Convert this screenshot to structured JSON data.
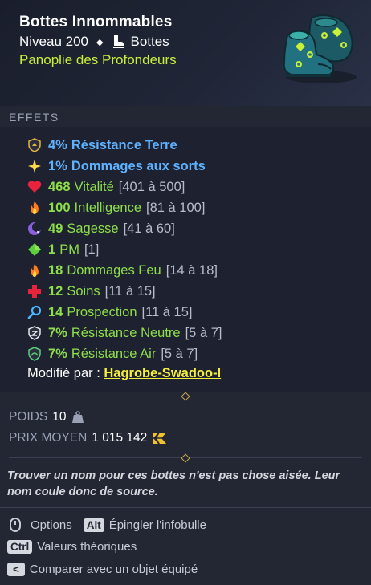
{
  "item": {
    "name": "Bottes Innommables",
    "level_text": "Niveau 200",
    "type": "Bottes",
    "set": "Panoplie des Profondeurs",
    "image_icon": "boots-icon"
  },
  "effects_label": "EFFETS",
  "effects": [
    {
      "icon": "earth-resistance-icon",
      "value": "4%",
      "name": "Résistance Terre",
      "range": "",
      "color": "#5fb2ff"
    },
    {
      "icon": "spell-damage-icon",
      "value": "1%",
      "name": "Dommages aux sorts",
      "range": "",
      "color": "#5fb2ff"
    },
    {
      "icon": "vitality-heart-icon",
      "value": "468",
      "name": "Vitalité",
      "range": "[401 à 500]",
      "color": "#8ede4a"
    },
    {
      "icon": "intelligence-fire-icon",
      "value": "100",
      "name": "Intelligence",
      "range": "[81 à 100]",
      "color": "#8ede4a"
    },
    {
      "icon": "wisdom-moon-icon",
      "value": "49",
      "name": "Sagesse",
      "range": "[41 à 60]",
      "color": "#8ede4a"
    },
    {
      "icon": "pm-diamond-icon",
      "value": "1",
      "name": "PM",
      "range": "[1]",
      "color": "#8ede4a"
    },
    {
      "icon": "fire-damage-icon",
      "value": "18",
      "name": "Dommages Feu",
      "range": "[14 à 18]",
      "color": "#8ede4a"
    },
    {
      "icon": "heals-cross-icon",
      "value": "12",
      "name": "Soins",
      "range": "[11 à 15]",
      "color": "#8ede4a"
    },
    {
      "icon": "prospecting-magnifier-icon",
      "value": "14",
      "name": "Prospection",
      "range": "[11 à 15]",
      "color": "#8ede4a"
    },
    {
      "icon": "neutral-resistance-icon",
      "value": "7%",
      "name": "Résistance Neutre",
      "range": "[5 à 7]",
      "color": "#8ede4a"
    },
    {
      "icon": "air-resistance-icon",
      "value": "7%",
      "name": "Résistance Air",
      "range": "[5 à 7]",
      "color": "#8ede4a"
    }
  ],
  "modified_by": {
    "label": "Modifié par :",
    "name": "Hagrobe-Swadoo-I"
  },
  "weight": {
    "label": "POIDS",
    "value": "10",
    "icon": "weight-icon"
  },
  "price": {
    "label": "PRIX MOYEN",
    "value": "1 015 142",
    "icon": "kamas-icon"
  },
  "lore": "Trouver un nom pour ces bottes n'est pas chose aisée. Leur nom coule donc de source.",
  "controls": {
    "options": "Options",
    "alt_key": "Alt",
    "pin": "Épingler l'infobulle",
    "ctrl_key": "Ctrl",
    "theoretical": "Valeurs théoriques",
    "lt_key": "<",
    "compare": "Comparer avec un objet équipé"
  }
}
